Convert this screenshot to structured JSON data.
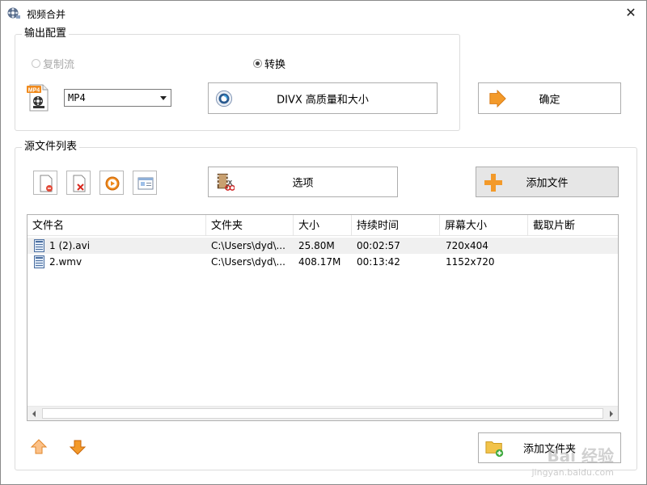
{
  "window": {
    "title": "视频合并",
    "close_glyph": "✕"
  },
  "output_config": {
    "label": "输出配置",
    "radio_copy_stream": "复制流",
    "radio_convert": "转换",
    "format_icon_text": "MP4",
    "format_value": "MP4",
    "quality_button": "DIVX 高质量和大小",
    "ok_button": "确定"
  },
  "source_list": {
    "label": "源文件列表",
    "options_button": "选项",
    "add_file_button": "添加文件",
    "add_folder_button": "添加文件夹",
    "columns": [
      "文件名",
      "文件夹",
      "大小",
      "持续时间",
      "屏幕大小",
      "截取片断"
    ],
    "rows": [
      {
        "name": "1 (2).avi",
        "folder": "C:\\Users\\dyd\\...",
        "size": "25.80M",
        "duration": "00:02:57",
        "screen": "720x404",
        "clip": ""
      },
      {
        "name": "2.wmv",
        "folder": "C:\\Users\\dyd\\...",
        "size": "408.17M",
        "duration": "00:13:42",
        "screen": "1152x720",
        "clip": ""
      }
    ]
  },
  "watermark": {
    "text": "Bai 经验",
    "sub": "jingyan.baidu.com"
  },
  "colors": {
    "accent_orange": "#f08a1c",
    "border": "#adadad",
    "selected_row": "#f0f0f0"
  },
  "icons": [
    "film-reel-icon",
    "mp4-file-icon",
    "quality-gear-icon",
    "arrow-right-icon",
    "add-page-icon",
    "delete-page-icon",
    "play-icon",
    "properties-icon",
    "film-scissors-icon",
    "plus-icon",
    "video-file-icon",
    "move-up-icon",
    "move-down-icon",
    "folder-add-icon"
  ]
}
